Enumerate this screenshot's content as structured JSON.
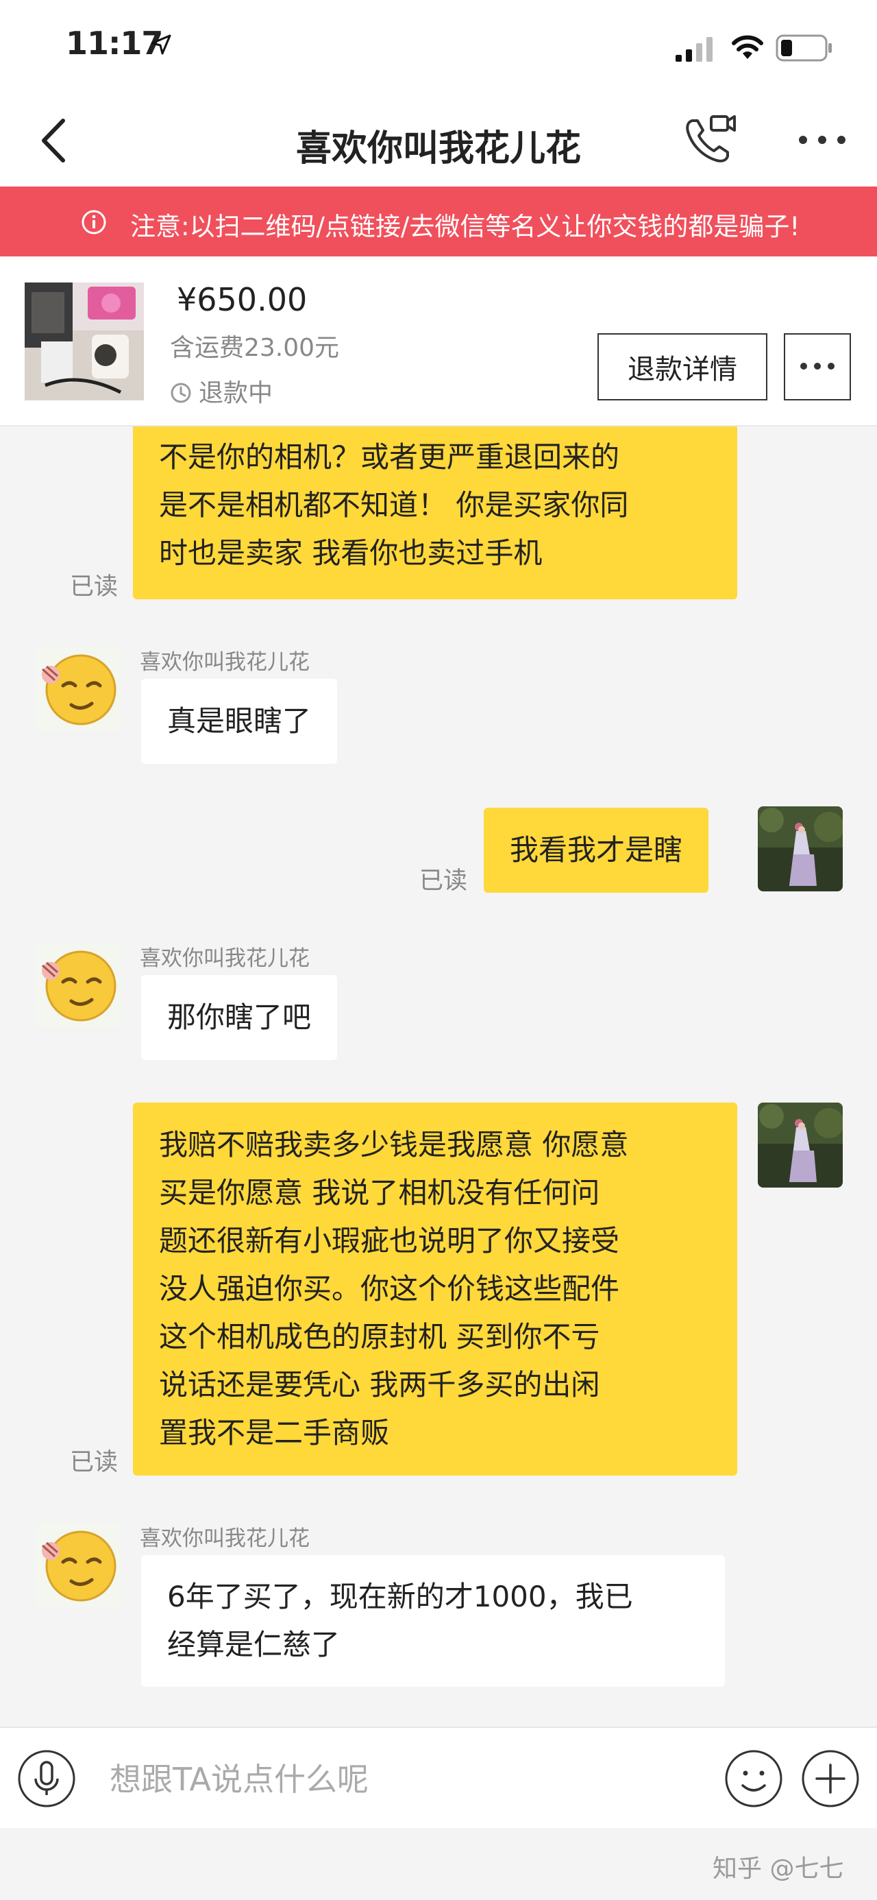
{
  "status_bar": {
    "time": "11:17"
  },
  "nav": {
    "title": "喜欢你叫我花儿花"
  },
  "warning": {
    "text": "注意:以扫二维码/点链接/去微信等名义让你交钱的都是骗子!"
  },
  "product": {
    "price": "¥650.00",
    "shipping": "含运费23.00元",
    "status": "退款中",
    "refund_button": "退款详情"
  },
  "messages": [
    {
      "from": "me",
      "lines": [
        "不是你的相机？或者更严重退回来的",
        "是不是相机都不知道！ 你是买家你同",
        "时也是卖家 我看你也卖过手机"
      ],
      "read": "已读"
    },
    {
      "from": "them",
      "sender": "喜欢你叫我花儿花",
      "lines": [
        "真是眼瞎了"
      ]
    },
    {
      "from": "me",
      "lines": [
        "我看我才是瞎"
      ],
      "read": "已读"
    },
    {
      "from": "them",
      "sender": "喜欢你叫我花儿花",
      "lines": [
        "那你瞎了吧"
      ]
    },
    {
      "from": "me",
      "lines": [
        "我赔不赔我卖多少钱是我愿意 你愿意",
        "买是你愿意  我说了相机没有任何问",
        "题还很新有小瑕疵也说明了你又接受",
        "没人强迫你买。你这个价钱这些配件",
        "这个相机成色的原封机 买到你不亏",
        "说话还是要凭心  我两千多买的出闲",
        "置我不是二手商贩"
      ],
      "read": "已读"
    },
    {
      "from": "them",
      "sender": "喜欢你叫我花儿花",
      "lines": [
        "6年了买了，现在新的才1000，我已",
        "经算是仁慈了"
      ]
    }
  ],
  "input": {
    "placeholder": "想跟TA说点什么呢"
  },
  "watermark": "知乎 @七七",
  "colors": {
    "warning_bg": "#f0505c",
    "my_bubble": "#ffd83a",
    "their_bubble": "#ffffff",
    "chat_bg": "#f4f4f4"
  }
}
